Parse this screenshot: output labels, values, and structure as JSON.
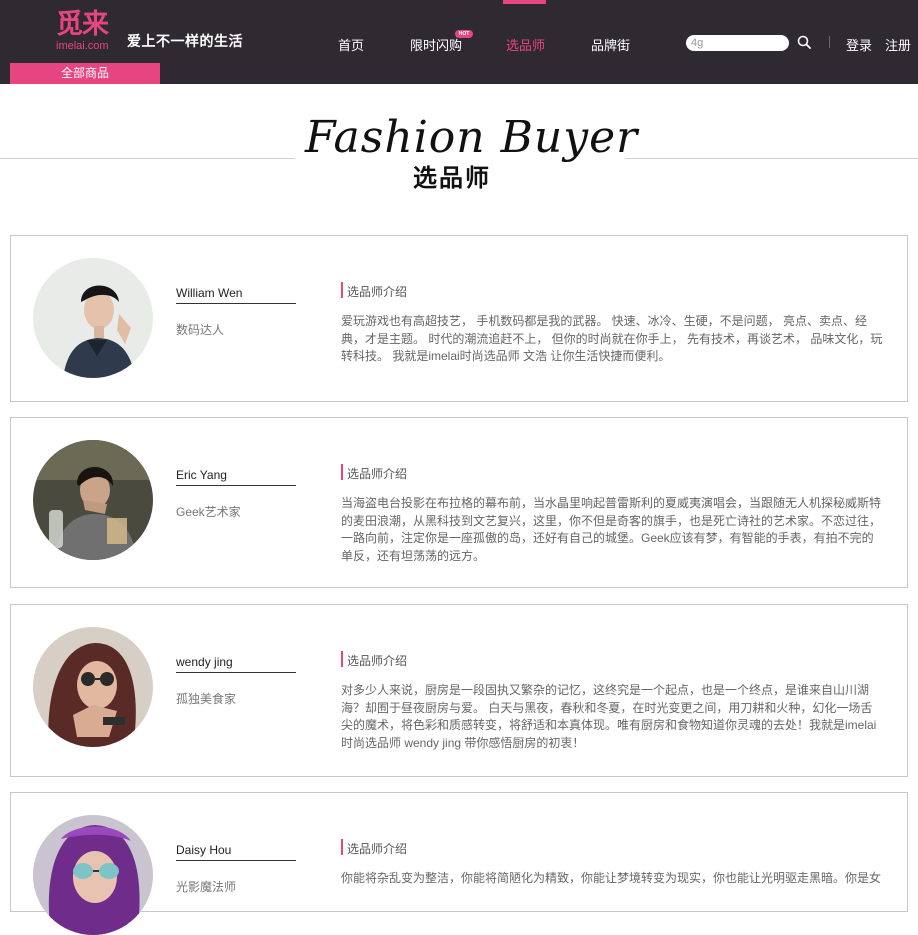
{
  "header": {
    "logo_main": "觅来",
    "logo_sub": "imelai.com",
    "slogan": "爱上不一样的生活",
    "all_goods": "全部商品",
    "nav": {
      "home": "首页",
      "flash": "限时闪购",
      "hot_badge": "HOT",
      "buyer": "选品师",
      "brand": "品牌街"
    },
    "search_value": "4g",
    "login": "登录",
    "register": "注册",
    "accent_color": "#e64580",
    "bg_color": "#2f2a31"
  },
  "page_title": {
    "en": "Fashion Buyer",
    "cn": "选品师"
  },
  "buyers": [
    {
      "name": "William Wen",
      "role": "数码达人",
      "intro_title": "选品师介绍",
      "intro": "爱玩游戏也有高超技艺， 手机数码都是我的武器。 快速、冰冷、生硬，不是问题， 亮点、卖点、经典，才是主题。 时代的潮流追赶不上， 但你的时尚就在你手上， 先有技术，再谈艺术， 品味文化，玩转科技。 我就是imelai时尚选品师 文浩 让你生活快捷而便利。"
    },
    {
      "name": "Eric Yang",
      "role": "Geek艺术家",
      "intro_title": "选品师介绍",
      "intro": "当海盗电台投影在布拉格的幕布前，当水晶里响起普雷斯利的夏威夷演唱会，当跟随无人机探秘威斯特的麦田浪潮，从黑科技到文艺复兴，这里，你不但是奇客的旗手，也是死亡诗社的艺术家。不恋过往，一路向前，注定你是一座孤傲的岛，还好有自己的城堡。Geek应该有梦，有智能的手表，有拍不完的单反，还有坦荡荡的远方。"
    },
    {
      "name": "wendy jing",
      "role": "孤独美食家",
      "intro_title": "选品师介绍",
      "intro": "对多少人来说，厨房是一段固执又繁杂的记忆，这终究是一个起点，也是一个终点，是谁来自山川湖海？却囿于昼夜厨房与爱。 白天与黑夜，春秋和冬夏，在时光变更之间，用刀耕和火种，幻化一场舌尖的魔术，将色彩和质感转变，将舒适和本真体现。唯有厨房和食物知道你灵魂的去处！我就是imelai时尚选品师 wendy jing 带你感悟厨房的初衷！"
    },
    {
      "name": "Daisy Hou",
      "role": "光影魔法师",
      "intro_title": "选品师介绍",
      "intro": "你能将杂乱变为整洁，你能将简陋化为精致，你能让梦境转变为现实，你也能让光明驱走黑暗。你是女"
    }
  ]
}
